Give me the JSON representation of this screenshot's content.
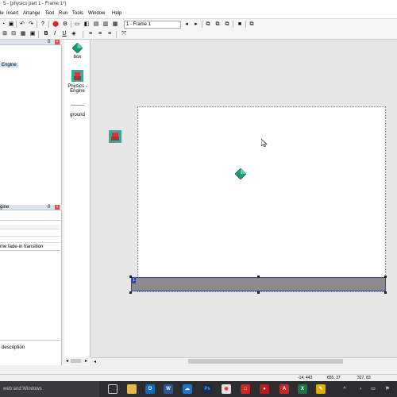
{
  "window": {
    "title": "5 - [physics part 1 - Frame 1*]"
  },
  "menubar": {
    "items": [
      "le",
      "Insert",
      "Arrange",
      "Text",
      "Run",
      "Tools",
      "Window",
      "Help"
    ]
  },
  "toolbar": {
    "frame_select": "1 - Frame 1"
  },
  "left_panel": {
    "top_label": "Engine",
    "top_pin": "p",
    "bottom_title": "gine",
    "transition_text": "me fade-in transition",
    "description_label": "description"
  },
  "object_bar": {
    "items": [
      {
        "label": "box",
        "icon": "diamond-icon"
      },
      {
        "label": "Physics - Engine",
        "icon": "physics-engine-icon"
      },
      {
        "label": "ground",
        "icon": "none"
      }
    ]
  },
  "canvas": {
    "ground_label": "1"
  },
  "status": {
    "coord1": "-14, 443",
    "coord2": "655, 37",
    "coord3": "327, 83"
  },
  "taskbar": {
    "search_text": "web and Windows"
  },
  "colors": {
    "selection_blue": "#3344aa",
    "ground_gray": "#8c8c8c",
    "diamond_teal": "#1a9a7a"
  }
}
